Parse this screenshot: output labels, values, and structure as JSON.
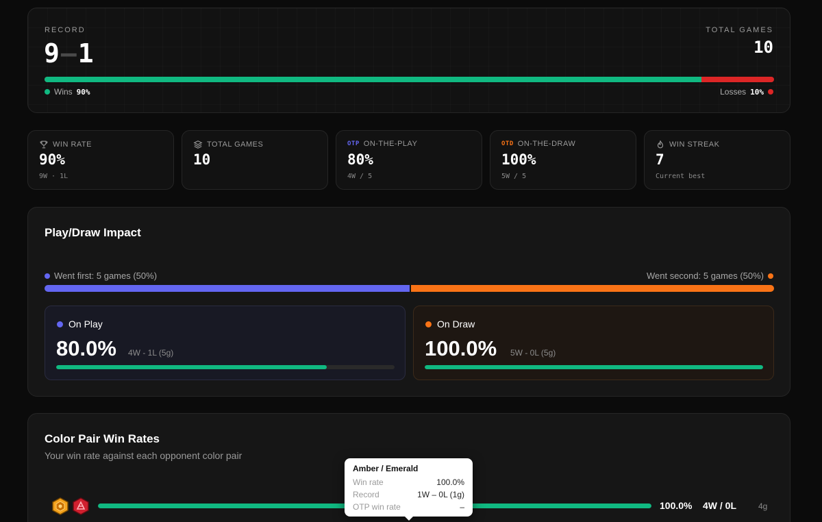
{
  "record": {
    "label": "RECORD",
    "wins": "9",
    "dash": "–",
    "losses": "1",
    "total_label": "TOTAL GAMES",
    "total_value": "10",
    "win_fraction": 0.9,
    "wins_legend": "Wins",
    "wins_pct": "90%",
    "losses_legend": "Losses",
    "losses_pct": "10%"
  },
  "stats": [
    {
      "icon": "trophy-icon",
      "tag": "",
      "label": "WIN RATE",
      "value": "90%",
      "sub": "9W · 1L"
    },
    {
      "icon": "layers-icon",
      "tag": "",
      "label": "TOTAL GAMES",
      "value": "10",
      "sub": ""
    },
    {
      "icon": "",
      "tag": "OTP",
      "tag_color": "#6366f1",
      "label": "ON-THE-PLAY",
      "value": "80%",
      "sub": "4W / 5"
    },
    {
      "icon": "",
      "tag": "OTD",
      "tag_color": "#f97316",
      "label": "ON-THE-DRAW",
      "value": "100%",
      "sub": "5W / 5"
    },
    {
      "icon": "flame-icon",
      "tag": "",
      "label": "WIN STREAK",
      "value": "7",
      "sub": "Current best"
    }
  ],
  "play_draw": {
    "title": "Play/Draw Impact",
    "first_legend": "Went first: 5 games (50%)",
    "second_legend": "Went second: 5 games (50%)",
    "first_fraction": 0.5,
    "on_play": {
      "title": "On Play",
      "pct": "80.0%",
      "record": "4W - 1L (5g)",
      "fraction": 0.8
    },
    "on_draw": {
      "title": "On Draw",
      "pct": "100.0%",
      "record": "5W - 0L (5g)",
      "fraction": 1.0
    }
  },
  "color_pairs": {
    "title": "Color Pair Win Rates",
    "subtitle": "Your win rate against each opponent color pair",
    "rows": [
      {
        "icons": [
          "amber-ink-icon",
          "ruby-ink-icon"
        ],
        "fraction": 1.0,
        "pct": "100.0%",
        "record": "4W / 0L",
        "games": "4g"
      }
    ]
  },
  "tooltip": {
    "title": "Amber / Emerald",
    "rows": [
      {
        "key": "Win rate",
        "value": "100.0%"
      },
      {
        "key": "Record",
        "value": "1W – 0L (1g)"
      },
      {
        "key": "OTP win rate",
        "value": "–"
      }
    ]
  },
  "colors": {
    "win": "#10b981",
    "loss": "#dc2626",
    "play": "#6366f1",
    "draw": "#f97316"
  }
}
